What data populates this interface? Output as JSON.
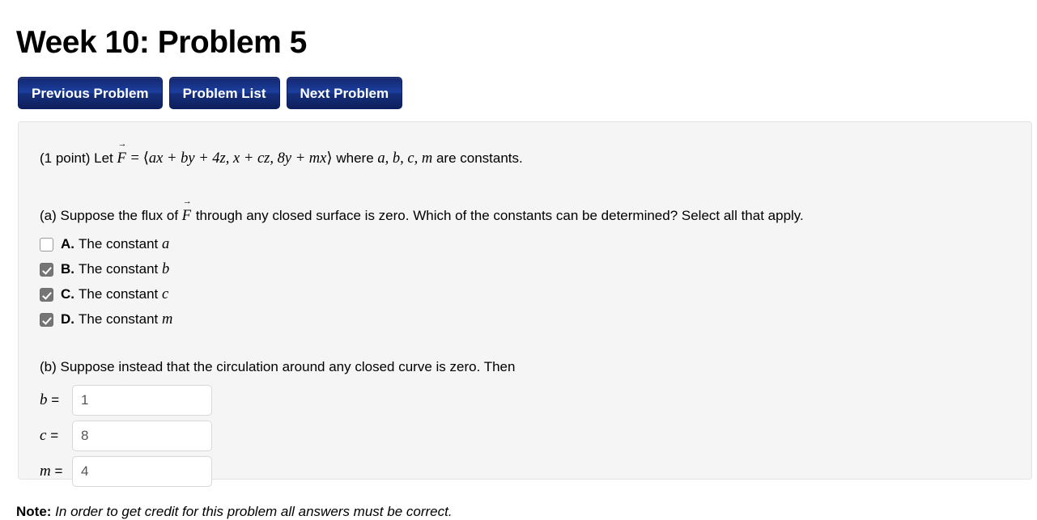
{
  "page_title": "Week 10: Problem 5",
  "nav": {
    "buttons": [
      {
        "label": "Previous Problem",
        "name": "previous-problem-button"
      },
      {
        "label": "Problem List",
        "name": "problem-list-button"
      },
      {
        "label": "Next Problem",
        "name": "next-problem-button"
      }
    ]
  },
  "problem": {
    "points": "(1 point)",
    "lead_text": "Let",
    "vector_symbol": "F",
    "equals": "=",
    "vector_open": "⟨",
    "vector_components": "ax + by + 4z,  x + cz,  8y + mx",
    "vector_close": "⟩",
    "where_text": "where",
    "constants_list": "a, b, c, m",
    "constants_tail": "are constants.",
    "part_a": {
      "prefix": "(a) Suppose the flux of",
      "suffix": "through any closed surface is zero. Which of the constants can be determined? Select all that apply.",
      "choices": [
        {
          "letter": "A.",
          "text": "The constant",
          "symbol": "a",
          "checked": false
        },
        {
          "letter": "B.",
          "text": "The constant",
          "symbol": "b",
          "checked": true
        },
        {
          "letter": "C.",
          "text": "The constant",
          "symbol": "c",
          "checked": true
        },
        {
          "letter": "D.",
          "text": "The constant",
          "symbol": "m",
          "checked": true
        }
      ]
    },
    "part_b": {
      "text": "(b) Suppose instead that the circulation around any closed curve is zero. Then",
      "answers": [
        {
          "symbol": "b",
          "eq": "=",
          "value": "1"
        },
        {
          "symbol": "c",
          "eq": "=",
          "value": "8"
        },
        {
          "symbol": "m",
          "eq": "=",
          "value": "4"
        }
      ]
    }
  },
  "footer": {
    "note_label": "Note:",
    "note_text": " In order to get credit for this problem all answers must be correct."
  },
  "colors": {
    "button_blue": "#16307e",
    "panel_bg": "#f5f5f5",
    "checkbox_checked": "#757575"
  }
}
